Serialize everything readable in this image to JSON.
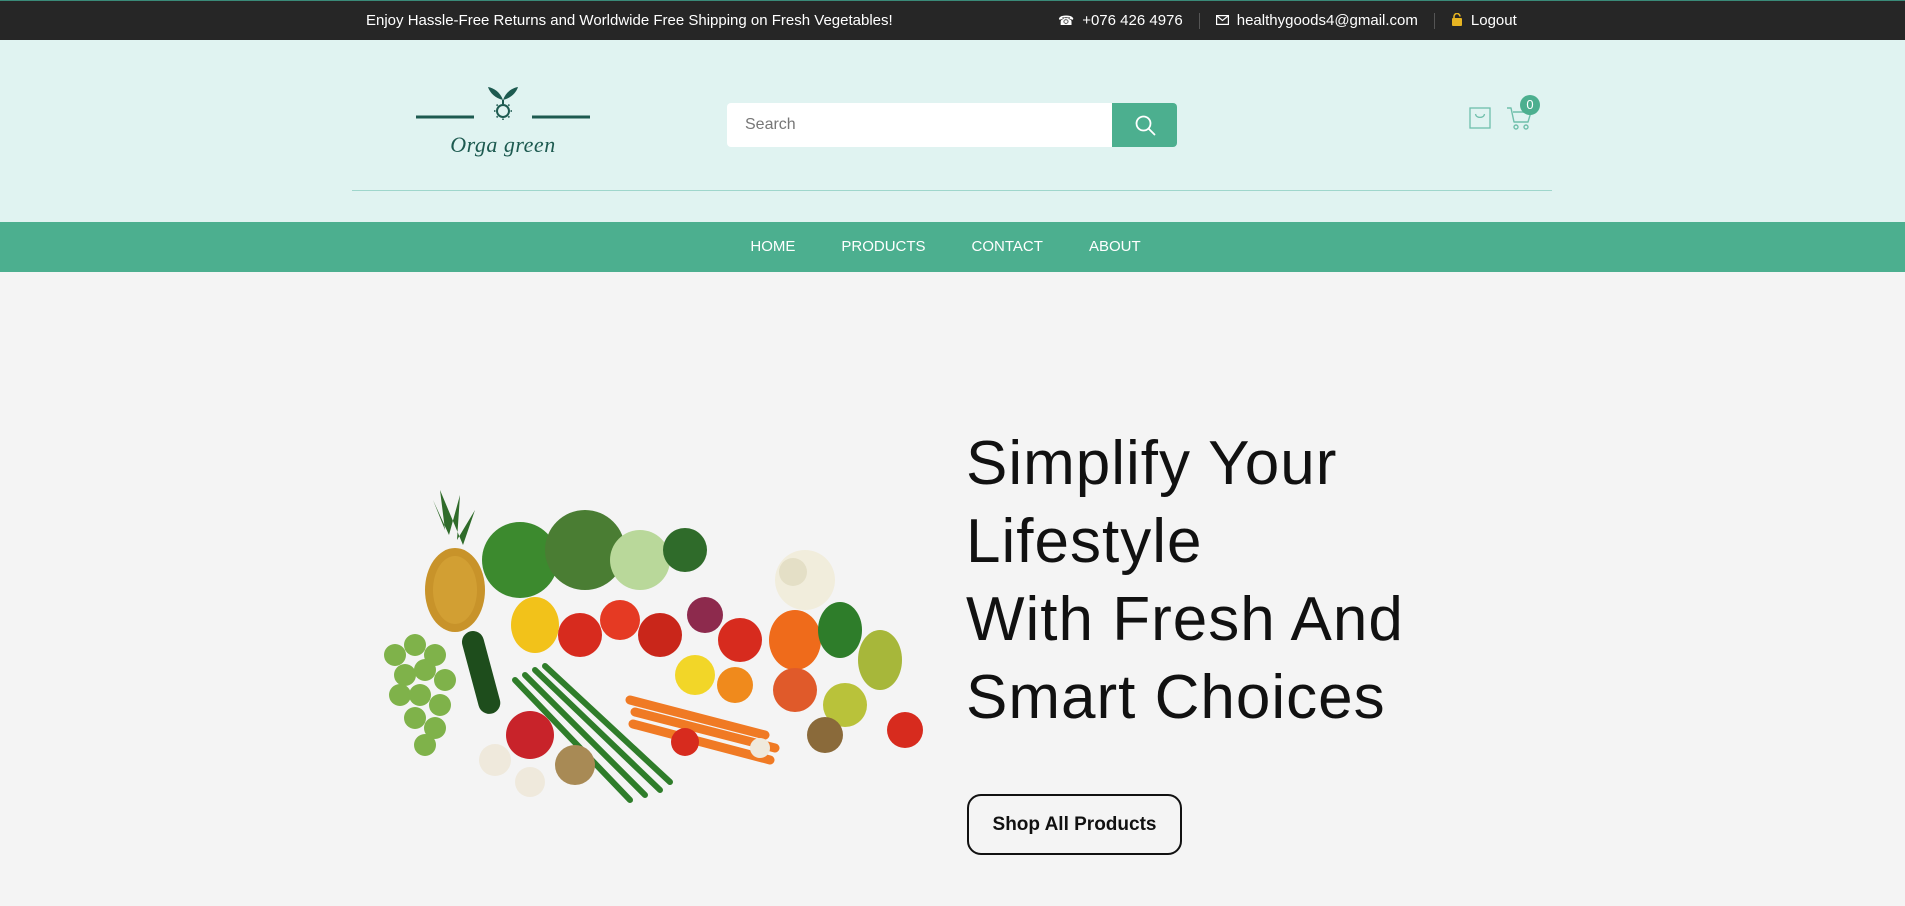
{
  "topbar": {
    "promo": "Enjoy Hassle-Free Returns and Worldwide Free Shipping on Fresh Vegetables!",
    "phone": "+076 426 4976",
    "email": "healthygoods4@gmail.com",
    "logout_label": "Logout"
  },
  "header": {
    "logo_text": "Orga green",
    "search_placeholder": "Search",
    "cart_count": "0"
  },
  "nav": {
    "items": [
      {
        "label": "HOME"
      },
      {
        "label": "PRODUCTS"
      },
      {
        "label": "CONTACT"
      },
      {
        "label": "ABOUT"
      }
    ]
  },
  "hero": {
    "title_lines": [
      "Simplify Your",
      "Lifestyle",
      "With Fresh And",
      "Smart Choices"
    ],
    "cta_label": "Shop All Products"
  },
  "colors": {
    "accent": "#4caf8f",
    "topbar": "#262626",
    "header_bg": "#e0f3f1",
    "body_bg": "#f4f4f4",
    "logo": "#1d5a50"
  },
  "icons": {
    "phone": "phone-icon",
    "email": "mail-icon",
    "logout": "lock-icon",
    "search": "search-icon",
    "bag": "shopping-bag-icon",
    "cart": "cart-icon"
  }
}
